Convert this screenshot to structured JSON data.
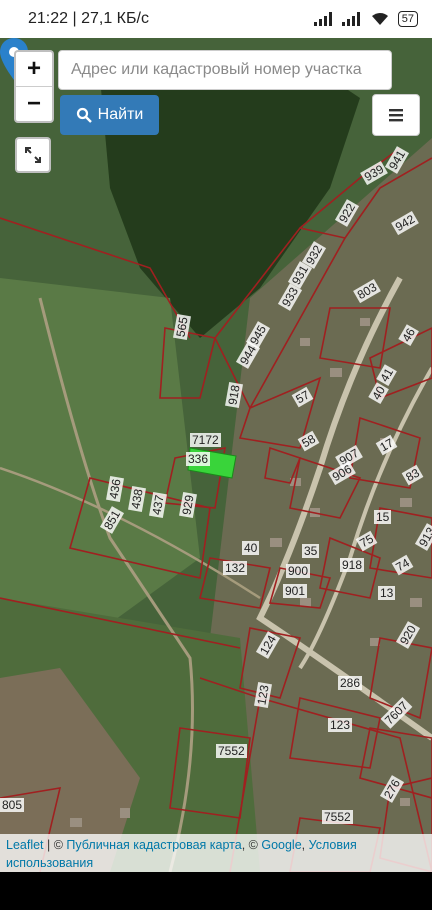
{
  "status": {
    "time_speed": "21:22 | 27,1 КБ/с",
    "battery": "57"
  },
  "controls": {
    "zoom_in": "+",
    "zoom_out": "−",
    "search_placeholder": "Адрес или кадастровый номер участка",
    "find_label": "Найти",
    "menu_symbol": "☰"
  },
  "attribution": {
    "leaflet": "Leaflet",
    "sep1": " | © ",
    "cadastral": "Публичная кадастровая карта",
    "sep2": ", © ",
    "google": "Google",
    "sep3": ", ",
    "terms": "Условия использования"
  },
  "plot_labels": [
    "941",
    "939",
    "922",
    "942",
    "932",
    "931",
    "933",
    "803",
    "565",
    "945",
    "944",
    "918",
    "57",
    "41",
    "40",
    "46",
    "7172",
    "336",
    "58",
    "907",
    "17",
    "906",
    "83",
    "436",
    "438",
    "437",
    "929",
    "851",
    "15",
    "40",
    "132",
    "35",
    "75",
    "918",
    "900",
    "901",
    "13",
    "74",
    "913",
    "124",
    "920",
    "286",
    "123",
    "7607",
    "123",
    "7552",
    "276",
    "805",
    "7552"
  ],
  "colors": {
    "parcel_border": "#a02020",
    "selected_parcel": "#39d43a",
    "marker": "#2a81cb",
    "button": "#337ab7"
  }
}
